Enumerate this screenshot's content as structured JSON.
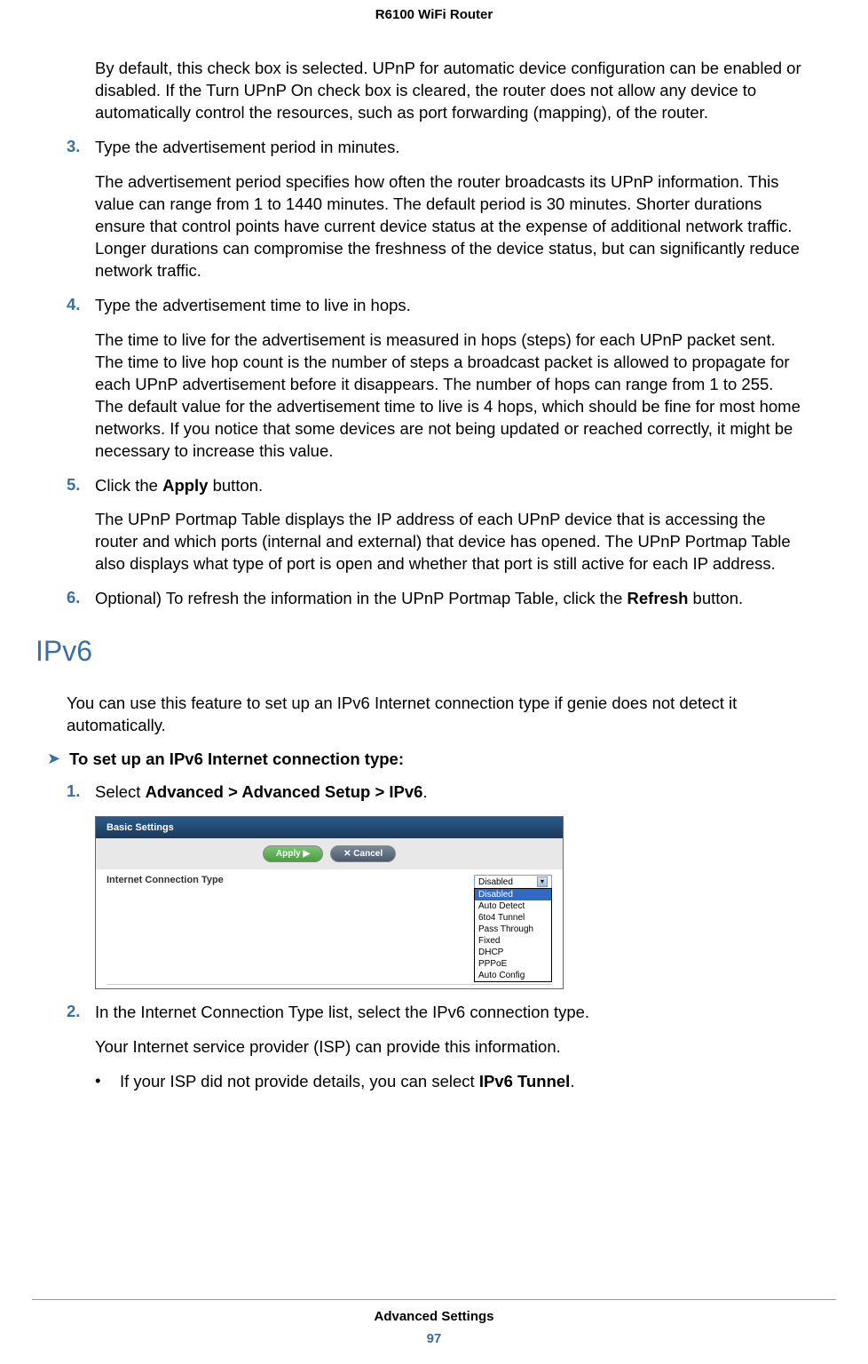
{
  "header": {
    "title": "R6100 WiFi Router"
  },
  "body": {
    "intro_para": "By default, this check box is selected. UPnP for automatic device configuration can be enabled or disabled. If the Turn UPnP On check box is cleared, the router does not allow any device to automatically control the resources, such as port forwarding (mapping), of the router.",
    "step3": {
      "num": "3.",
      "text": "Type the advertisement period in minutes.",
      "desc": "The advertisement period specifies how often the router broadcasts its UPnP information. This value can range from 1 to 1440 minutes. The default period is 30 minutes. Shorter durations ensure that control points have current device status at the expense of additional network traffic. Longer durations can compromise the freshness of the device status, but can significantly reduce network traffic."
    },
    "step4": {
      "num": "4.",
      "text": "Type the advertisement time to live in hops.",
      "desc": "The time to live for the advertisement is measured in hops (steps) for each UPnP packet sent. The time to live hop count is the number of steps a broadcast packet is allowed to propagate for each UPnP advertisement before it disappears. The number of hops can range from 1 to 255. The default value for the advertisement time to live is 4 hops, which should be fine for most home networks. If you notice that some devices are not being updated or reached correctly, it might be necessary to increase this value."
    },
    "step5": {
      "num": "5.",
      "text_pre": "Click the ",
      "text_bold": "Apply",
      "text_post": " button.",
      "desc": "The UPnP Portmap Table displays the IP address of each UPnP device that is accessing the router and which ports (internal and external) that device has opened. The UPnP Portmap Table also displays what type of port is open and whether that port is still active for each IP address."
    },
    "step6": {
      "num": "6.",
      "text_pre": "Optional) To refresh the information in the UPnP Portmap Table, click the ",
      "text_bold": "Refresh",
      "text_post": " button."
    },
    "section_title": "IPv6",
    "section_intro": "You can use this feature to set up an IPv6 Internet connection type if genie does not detect it automatically.",
    "task_arrow": "➤",
    "task_title": "To set up an IPv6 Internet connection type:",
    "setup_step1": {
      "num": "1.",
      "text_pre": "Select ",
      "text_bold": "Advanced > Advanced Setup > IPv6",
      "text_post": "."
    },
    "screenshot": {
      "titlebar": "Basic Settings",
      "apply_btn": "Apply ▶",
      "cancel_btn": "✕ Cancel",
      "label": "Internet Connection Type",
      "selected": "Disabled",
      "options": [
        "Disabled",
        "Auto Detect",
        "6to4 Tunnel",
        "Pass Through",
        "Fixed",
        "DHCP",
        "PPPoE",
        "Auto Config"
      ]
    },
    "setup_step2": {
      "num": "2.",
      "text": "In the Internet Connection Type list, select the IPv6 connection type.",
      "desc": "Your Internet service provider (ISP) can provide this information."
    },
    "bullet1": {
      "dot": "•",
      "text_pre": "If your ISP did not provide details, you can select ",
      "text_bold": "IPv6 Tunnel",
      "text_post": "."
    }
  },
  "footer": {
    "title": "Advanced Settings",
    "page": "97"
  }
}
